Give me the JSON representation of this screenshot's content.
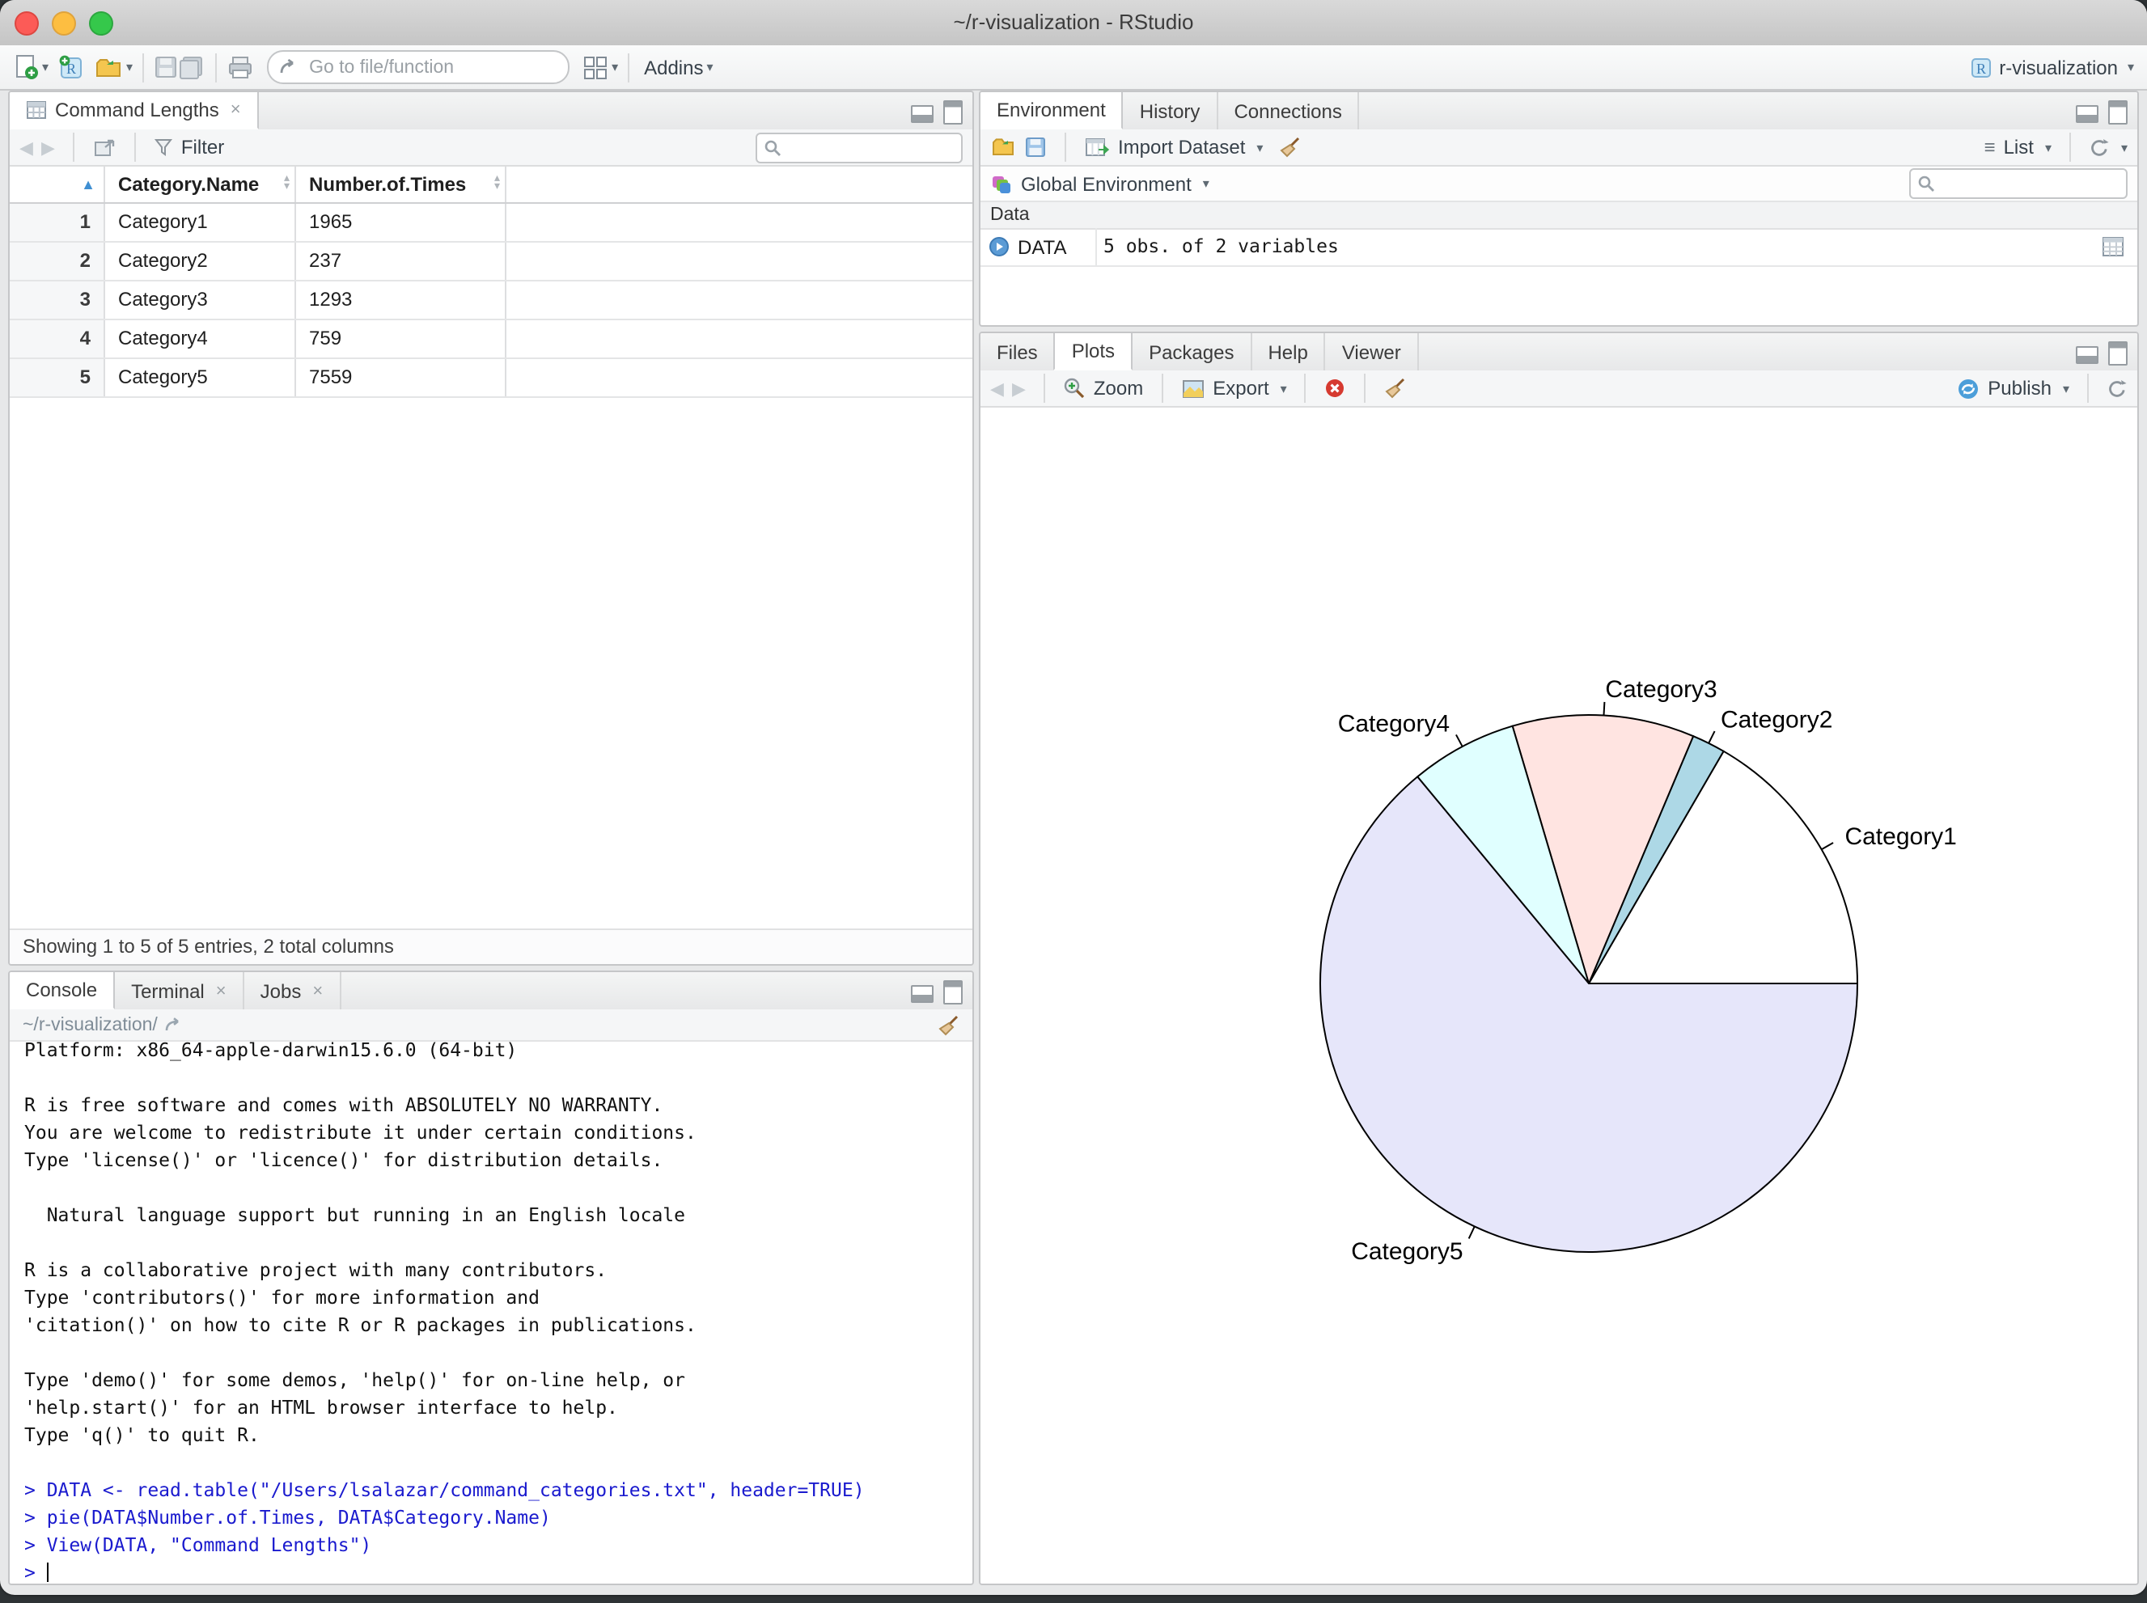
{
  "window": {
    "title": "~/r-visualization - RStudio"
  },
  "glyphs": {
    "close": "×",
    "caret": "▾",
    "sort_up": "▲",
    "mini_up": "▴",
    "mini_down": "▾",
    "back": "◀",
    "fwd": "▶",
    "list": "≡"
  },
  "toolbar": {
    "goto_placeholder": "Go to file/function",
    "addins_label": "Addins",
    "project_label": "r-visualization"
  },
  "viewer_pane": {
    "tab": "Command Lengths",
    "filter_label": "Filter",
    "status": "Showing 1 to 5 of 5 entries, 2 total columns",
    "table": {
      "columns": [
        "Category.Name",
        "Number.of.Times"
      ],
      "rows": [
        {
          "n": "1",
          "name": "Category1",
          "times": "1965"
        },
        {
          "n": "2",
          "name": "Category2",
          "times": "237"
        },
        {
          "n": "3",
          "name": "Category3",
          "times": "1293"
        },
        {
          "n": "4",
          "name": "Category4",
          "times": "759"
        },
        {
          "n": "5",
          "name": "Category5",
          "times": "7559"
        }
      ]
    }
  },
  "environment_pane": {
    "tabs": [
      "Environment",
      "History",
      "Connections"
    ],
    "import_label": "Import Dataset",
    "list_label": "List",
    "scope_label": "Global Environment",
    "section_label": "Data",
    "object": {
      "name": "DATA",
      "value": "5 obs. of 2 variables"
    }
  },
  "plots_pane": {
    "tabs": [
      "Files",
      "Plots",
      "Packages",
      "Help",
      "Viewer"
    ],
    "zoom_label": "Zoom",
    "export_label": "Export",
    "publish_label": "Publish"
  },
  "console_pane": {
    "tabs": [
      "Console",
      "Terminal",
      "Jobs"
    ],
    "path": "~/r-visualization/",
    "lines": [
      {
        "text": "Platform: x86_64-apple-darwin15.6.0 (64-bit)",
        "type": "output"
      },
      {
        "text": "",
        "type": "output"
      },
      {
        "text": "R is free software and comes with ABSOLUTELY NO WARRANTY.",
        "type": "output"
      },
      {
        "text": "You are welcome to redistribute it under certain conditions.",
        "type": "output"
      },
      {
        "text": "Type 'license()' or 'licence()' for distribution details.",
        "type": "output"
      },
      {
        "text": "",
        "type": "output"
      },
      {
        "text": "  Natural language support but running in an English locale",
        "type": "output"
      },
      {
        "text": "",
        "type": "output"
      },
      {
        "text": "R is a collaborative project with many contributors.",
        "type": "output"
      },
      {
        "text": "Type 'contributors()' for more information and",
        "type": "output"
      },
      {
        "text": "'citation()' on how to cite R or R packages in publications.",
        "type": "output"
      },
      {
        "text": "",
        "type": "output"
      },
      {
        "text": "Type 'demo()' for some demos, 'help()' for on-line help, or",
        "type": "output"
      },
      {
        "text": "'help.start()' for an HTML browser interface to help.",
        "type": "output"
      },
      {
        "text": "Type 'q()' to quit R.",
        "type": "output"
      },
      {
        "text": "",
        "type": "output"
      },
      {
        "text": "> DATA <- read.table(\"/Users/lsalazar/command_categories.txt\", header=TRUE)",
        "type": "command"
      },
      {
        "text": "> pie(DATA$Number.of.Times, DATA$Category.Name)",
        "type": "command"
      },
      {
        "text": "> View(DATA, \"Command Lengths\")",
        "type": "command"
      },
      {
        "text": "> ",
        "type": "command",
        "cursor": true
      }
    ]
  },
  "chart_data": {
    "type": "pie",
    "title": "",
    "categories": [
      "Category1",
      "Category2",
      "Category3",
      "Category4",
      "Category5"
    ],
    "values": [
      1965,
      237,
      1293,
      759,
      7559
    ],
    "colors": [
      "#FFFFFF",
      "#ADD8E6",
      "#FFE4E1",
      "#E0FFFF",
      "#E6E6FA"
    ],
    "start_angle_deg": 0,
    "direction": "counterclockwise",
    "stroke": "#000000",
    "legend": "none",
    "label_radius": 1.1
  }
}
